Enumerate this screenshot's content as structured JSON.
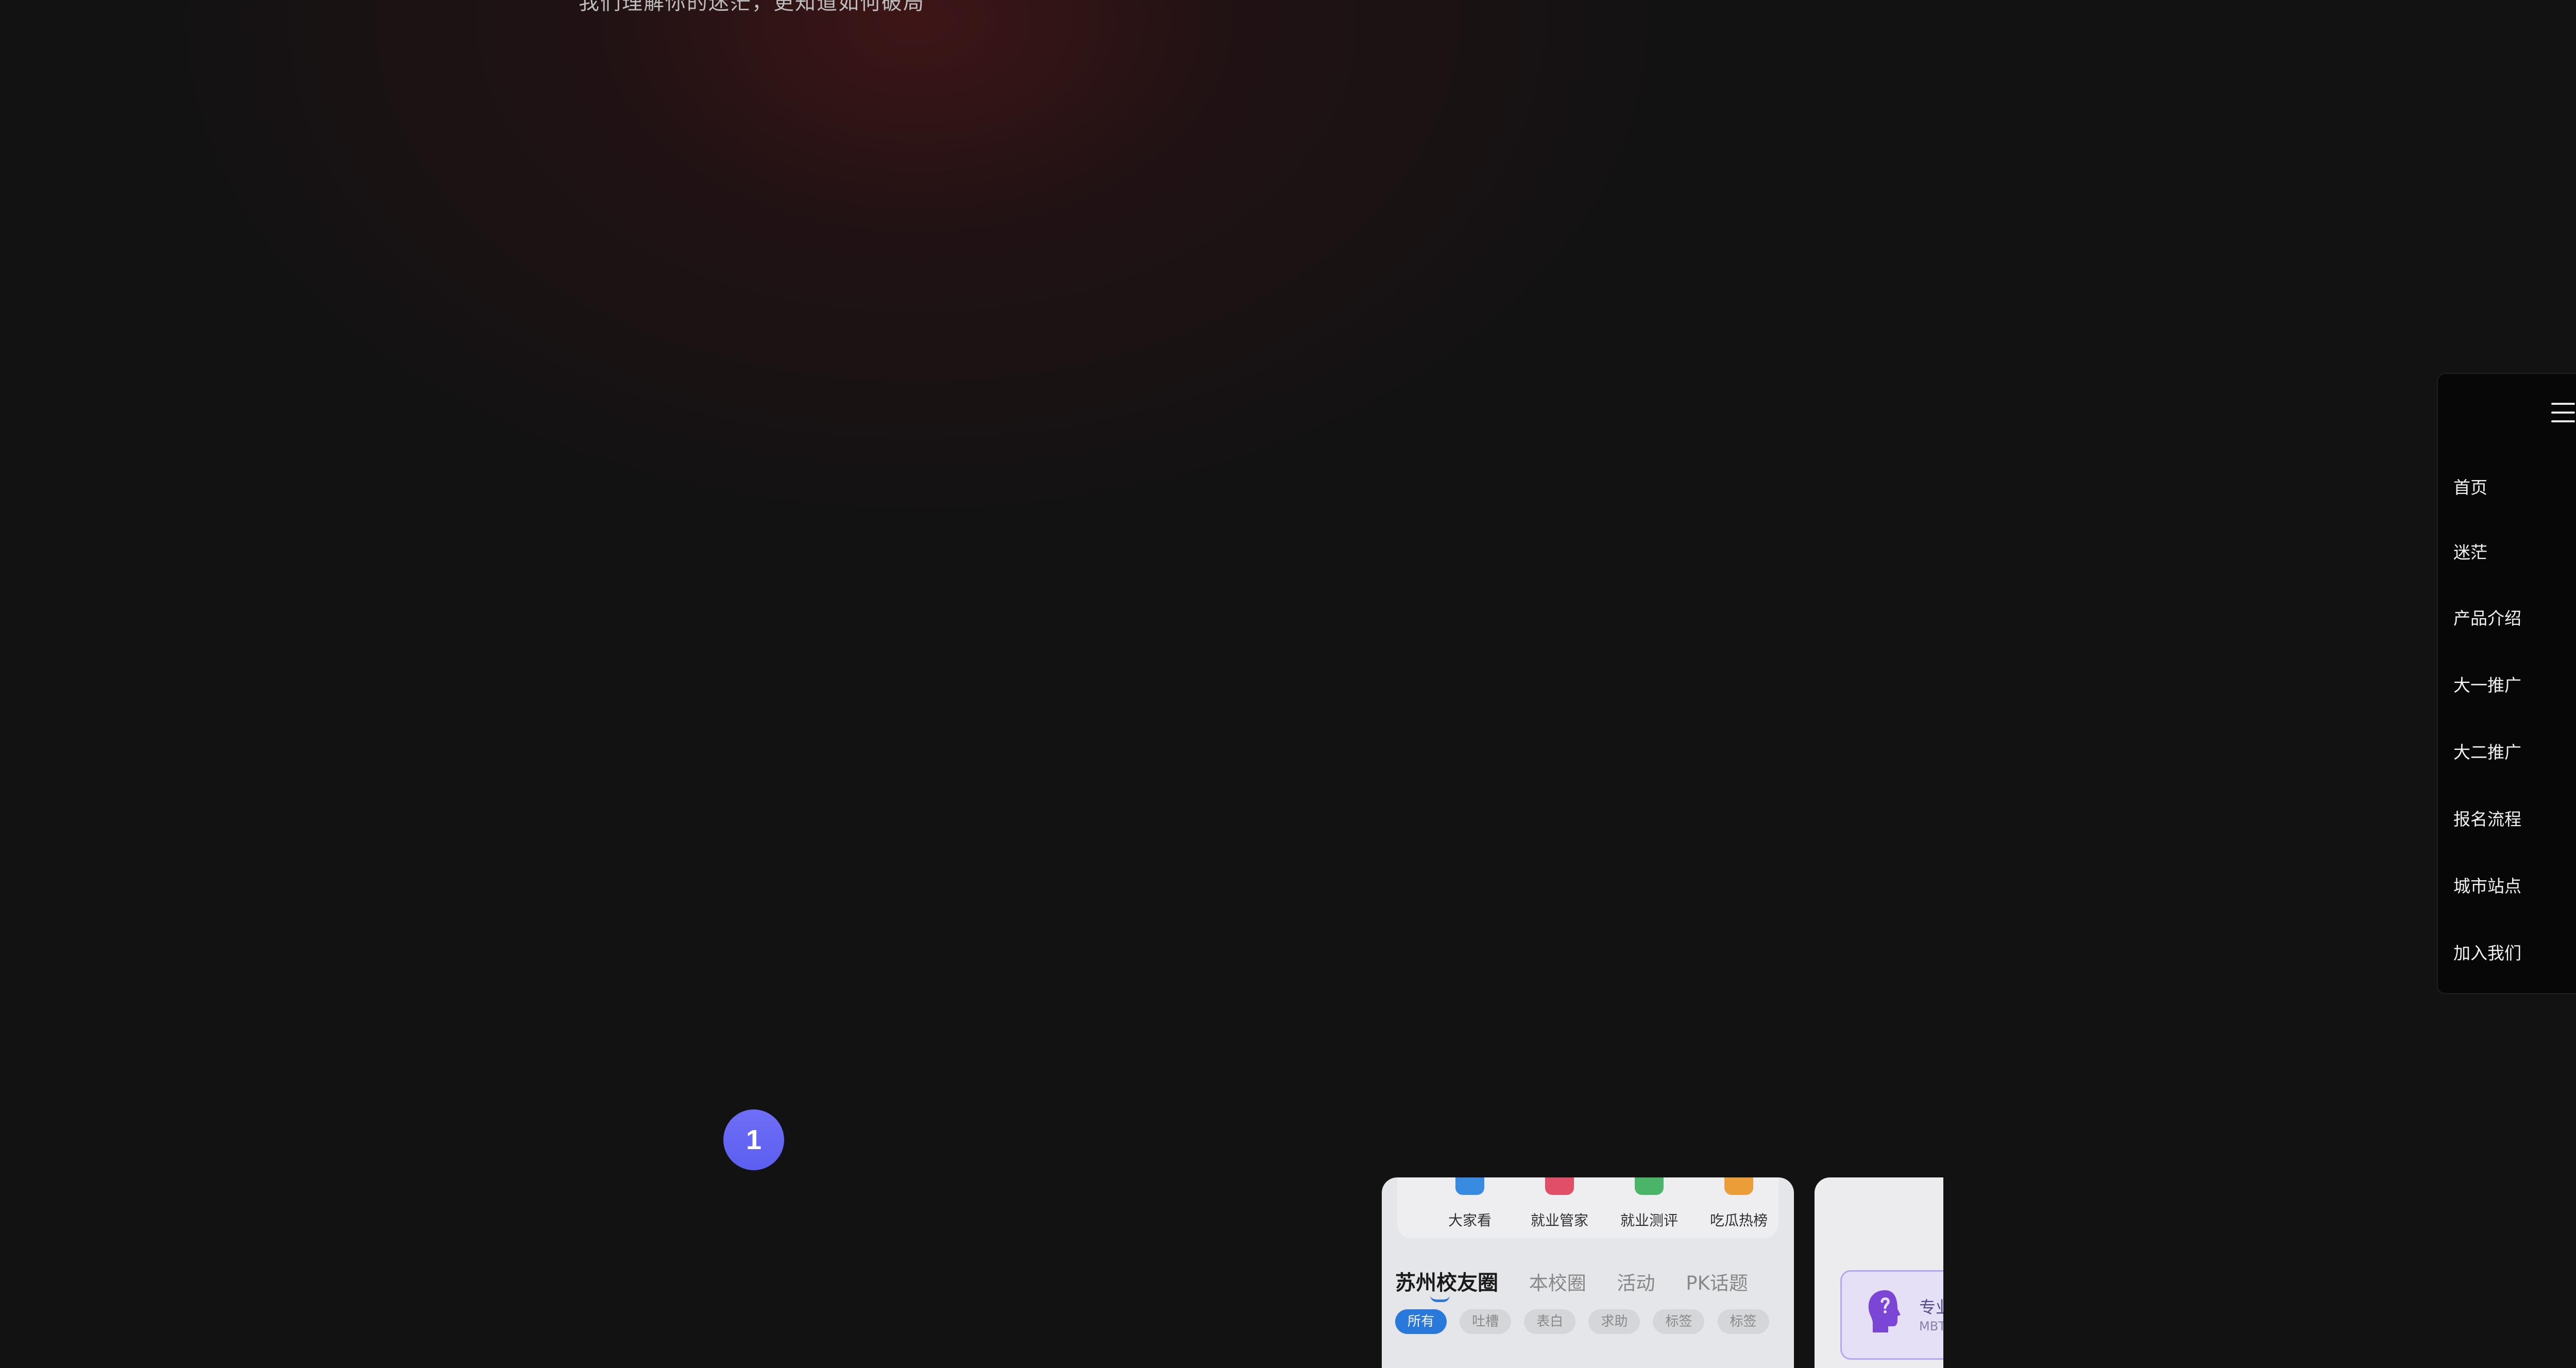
{
  "hero": {
    "subtitle": "我们理解你的迷茫，更知道如何破局"
  },
  "nav": {
    "menu_icon": "hamburger-menu-icon",
    "items": [
      {
        "label": "首页"
      },
      {
        "label": "迷茫"
      },
      {
        "label": "产品介绍"
      },
      {
        "label": "大一推广"
      },
      {
        "label": "大二推广"
      },
      {
        "label": "报名流程"
      },
      {
        "label": "城市站点"
      },
      {
        "label": "加入我们"
      }
    ]
  },
  "step": {
    "number": "1"
  },
  "phone": {
    "quick_actions": [
      {
        "label": "大家看",
        "icon": "chat-icon",
        "color": "#3b8ee8"
      },
      {
        "label": "就业管家",
        "icon": "briefcase-icon",
        "color": "#e8506a"
      },
      {
        "label": "就业测评",
        "icon": "assessment-icon",
        "color": "#4cbb6c"
      },
      {
        "label": "吃瓜热榜",
        "icon": "hot-list-icon",
        "color": "#f2a23a"
      }
    ],
    "tabs": [
      {
        "label": "苏州校友圈"
      },
      {
        "label": "本校圈"
      },
      {
        "label": "活动"
      },
      {
        "label": "PK话题"
      }
    ],
    "filters": [
      {
        "label": "所有"
      },
      {
        "label": "吐槽"
      },
      {
        "label": "表白"
      },
      {
        "label": "求助"
      },
      {
        "label": "标签"
      },
      {
        "label": "标签"
      }
    ]
  },
  "second_card": {
    "title": "专业",
    "subtitle": "MBTI",
    "icon": "head-profile-icon"
  },
  "colors": {
    "background": "#121213",
    "accent_purple": "#6366f1",
    "chip_active": "#2a7de1"
  }
}
